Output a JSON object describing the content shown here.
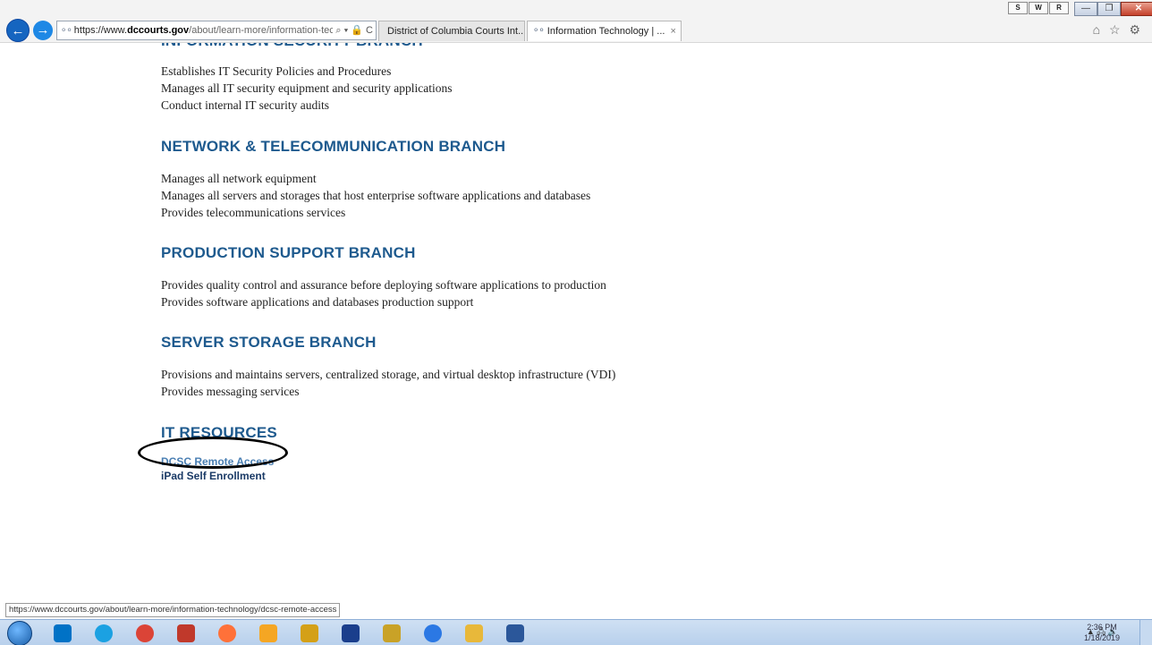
{
  "browser": {
    "url_prefix": "https://www.",
    "url_domain": "dccourts.gov",
    "url_rest": "/about/learn-more/information-techn",
    "tools_label": "⌕ ▾ 🔒 C",
    "tabs": [
      {
        "label": "District of Columbia Courts Int..."
      },
      {
        "label": "Information Technology | ...",
        "close": "×"
      }
    ],
    "user_buttons": [
      "S",
      "W",
      "R"
    ],
    "window_buttons": [
      "—",
      "❐",
      "✕"
    ],
    "right_icons": "⌂ ☆ ⚙"
  },
  "page": {
    "security_heading": "INFORMATION SECURITY BRANCH",
    "security_items": [
      "Establishes IT Security Policies and Procedures",
      "Manages all IT security equipment and security applications",
      "Conduct internal IT security audits"
    ],
    "network_heading": "NETWORK & TELECOMMUNICATION BRANCH",
    "network_items": [
      "Manages all network equipment",
      "Manages all servers and storages that host enterprise software applications and databases",
      "Provides telecommunications services"
    ],
    "production_heading": "PRODUCTION SUPPORT BRANCH",
    "production_items": [
      "Provides quality control and assurance before deploying software applications to production",
      "Provides software applications and databases production support"
    ],
    "server_heading": "SERVER STORAGE BRANCH",
    "server_items": [
      "Provisions and maintains servers, centralized storage, and virtual desktop infrastructure (VDI)",
      "Provides messaging services"
    ],
    "resources_heading": "IT RESOURCES",
    "resources_links": [
      "DCSC Remote Access",
      "iPad Self Enrollment"
    ]
  },
  "status_bar": {
    "hover_url": "https://www.dccourts.gov/about/learn-more/information-technology/dcsc-remote-access"
  },
  "taskbar": {
    "time": "2:36 PM",
    "date": "1/18/2019",
    "tray": "▲ 🖧 🔈",
    "items": [
      "outlook-icon",
      "internet-explorer-icon",
      "chrome-icon",
      "avaya-icon",
      "firefox-icon",
      "mail-icon",
      "app-icon",
      "windows-store-icon",
      "sticky-icon",
      "browser-icon",
      "folder-icon",
      "word-icon"
    ],
    "item_colors": [
      "#0072c6",
      "#1ba1e2",
      "#db4437",
      "#c0392b",
      "#ff7139",
      "#f5a623",
      "#d4a017",
      "#1a3e8c",
      "#c9a227",
      "#2b78e4",
      "#e8b83a",
      "#2b579a"
    ]
  }
}
